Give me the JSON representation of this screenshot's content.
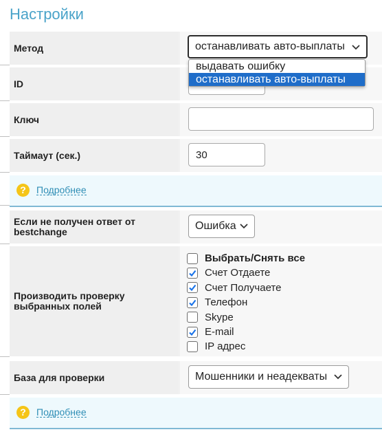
{
  "page": {
    "title": "Настройки"
  },
  "rows": {
    "method": {
      "label": "Метод",
      "value": "останавливать авто-выплаты",
      "options": [
        "выдавать ошибку",
        "останавливать авто-выплаты"
      ],
      "selected_index": 1
    },
    "id": {
      "label": "ID",
      "value": ""
    },
    "key": {
      "label": "Ключ",
      "value": ""
    },
    "timeout": {
      "label": "Таймаут (сек.)",
      "value": "30"
    },
    "no_response": {
      "label": "Если не получен ответ от bestchange",
      "value": "Ошибка"
    },
    "check_fields": {
      "label": "Производить проверку выбранных полей",
      "items": [
        {
          "label": "Выбрать/Снять все",
          "checked": false
        },
        {
          "label": "Счет Отдаете",
          "checked": true
        },
        {
          "label": "Счет Получаете",
          "checked": true
        },
        {
          "label": "Телефон",
          "checked": true
        },
        {
          "label": "Skype",
          "checked": false
        },
        {
          "label": "E-mail",
          "checked": true
        },
        {
          "label": "IP адрес",
          "checked": false
        }
      ]
    },
    "base": {
      "label": "База для проверки",
      "value": "Мошенники и неадекваты"
    }
  },
  "info": {
    "more_link": "Подробнее",
    "icon": "question-icon"
  },
  "colors": {
    "accent": "#4aa3c9",
    "link": "#2e8db5",
    "highlight": "#1f6dc9",
    "check": "#1a73e8"
  }
}
